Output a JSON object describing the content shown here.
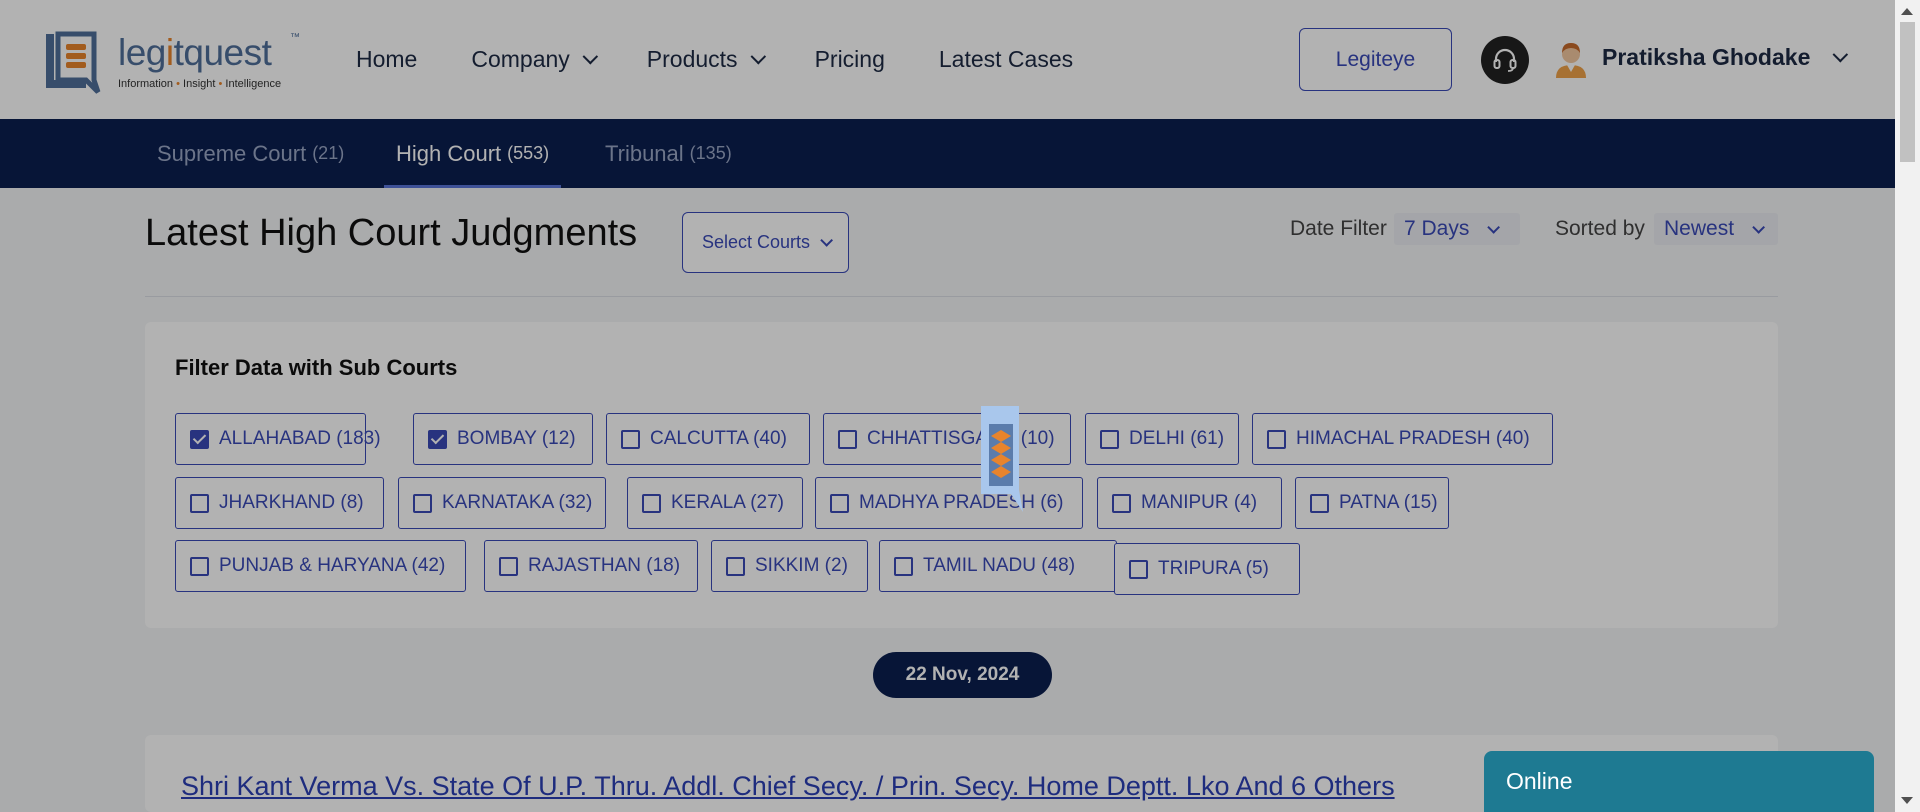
{
  "header": {
    "logo": {
      "wordmark_left": "leg",
      "wordmark_accent": "i",
      "wordmark_right": "tquest",
      "trademark": "™",
      "tagline_1": "Information",
      "tagline_sep": "•",
      "tagline_2": "Insight",
      "tagline_3": "Intelligence"
    },
    "nav": [
      {
        "label": "Home",
        "has_dropdown": false
      },
      {
        "label": "Company",
        "has_dropdown": true
      },
      {
        "label": "Products",
        "has_dropdown": true
      },
      {
        "label": "Pricing",
        "has_dropdown": false
      },
      {
        "label": "Latest Cases",
        "has_dropdown": false
      }
    ],
    "legiteye_label": "Legiteye",
    "support_icon": "headset-icon",
    "user": {
      "name": "Pratiksha Ghodake",
      "avatar_icon": "user-avatar-icon"
    }
  },
  "tabs": [
    {
      "label": "Supreme Court",
      "count": "(21)",
      "active": false
    },
    {
      "label": "High Court",
      "count": "(553)",
      "active": true
    },
    {
      "label": "Tribunal",
      "count": "(135)",
      "active": false
    }
  ],
  "main": {
    "title": "Latest High Court Judgments",
    "select_courts_label": "Select Courts",
    "date_filter": {
      "label": "Date Filter",
      "value": "7 Days"
    },
    "sort": {
      "label": "Sorted by",
      "value": "Newest"
    }
  },
  "filter": {
    "heading": "Filter Data with Sub Courts",
    "chips": [
      {
        "label": "ALLAHABAD (183)",
        "checked": true
      },
      {
        "label": "BOMBAY (12)",
        "checked": true
      },
      {
        "label": "CALCUTTA (40)",
        "checked": false
      },
      {
        "label": "CHHATTISGARH (10)",
        "checked": false
      },
      {
        "label": "DELHI (61)",
        "checked": false
      },
      {
        "label": "HIMACHAL PRADESH (40)",
        "checked": false
      },
      {
        "label": "JHARKHAND (8)",
        "checked": false
      },
      {
        "label": "KARNATAKA (32)",
        "checked": false
      },
      {
        "label": "KERALA (27)",
        "checked": false
      },
      {
        "label": "MADHYA PRADESH (6)",
        "checked": false
      },
      {
        "label": "MANIPUR (4)",
        "checked": false
      },
      {
        "label": "PATNA (15)",
        "checked": false
      },
      {
        "label": "PUNJAB & HARYANA (42)",
        "checked": false
      },
      {
        "label": "RAJASTHAN (18)",
        "checked": false
      },
      {
        "label": "SIKKIM (2)",
        "checked": false
      },
      {
        "label": "TAMIL NADU (48)",
        "checked": false
      },
      {
        "label": "TRIPURA (5)",
        "checked": false
      }
    ]
  },
  "date_group": "22 Nov, 2024",
  "cases": [
    {
      "title": "Shri Kant Verma Vs. State Of U.P. Thru. Addl. Chief Secy. / Prin. Secy. Home Deptt. Lko And 6 Others"
    }
  ],
  "chat": {
    "status": "Online"
  },
  "colors": {
    "navy": "#0b1f4f",
    "accent_blue": "#3a4ab7",
    "brand_orange": "#e8842c",
    "chat_teal": "#1e7a92"
  }
}
